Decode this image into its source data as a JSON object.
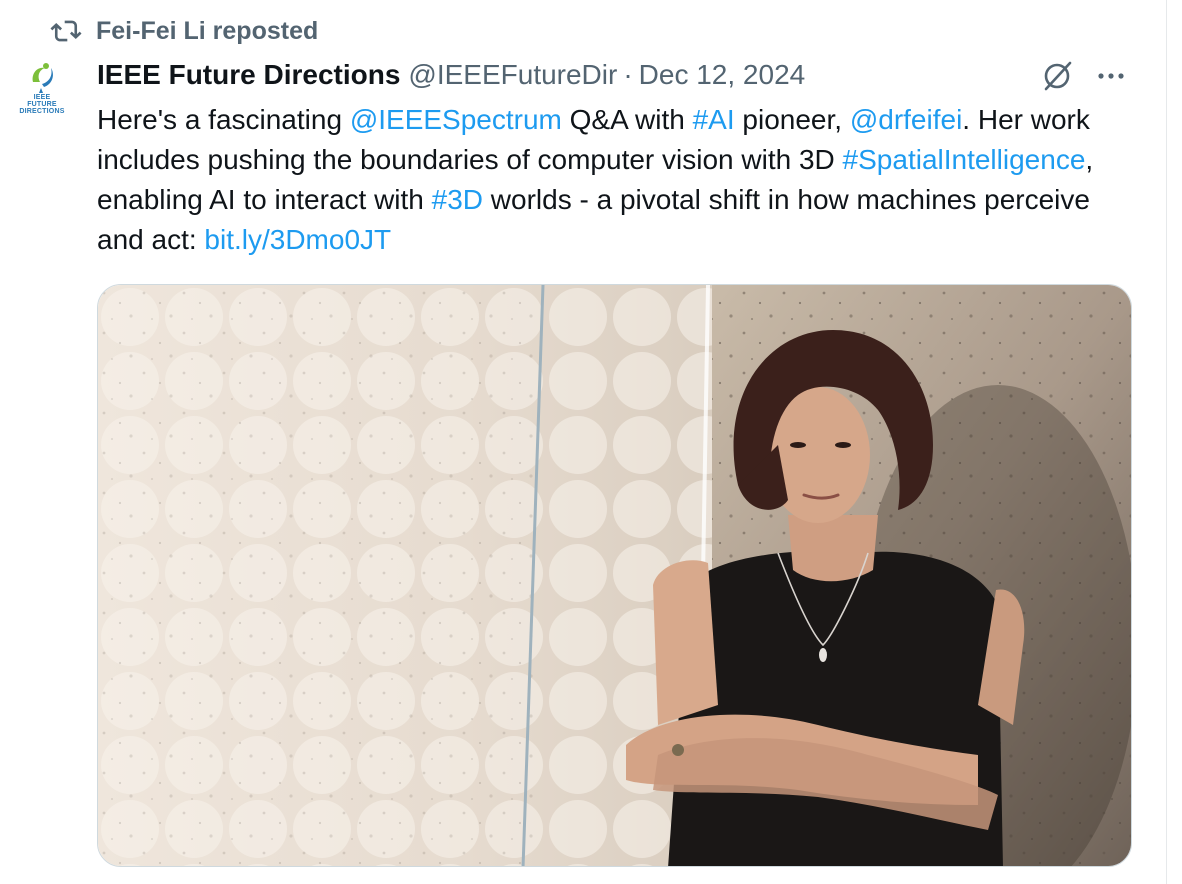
{
  "repost": {
    "label": "Fei-Fei Li reposted",
    "icon": "repost-icon"
  },
  "author": {
    "avatar_lines": [
      "IEEE",
      "FUTURE",
      "DIRECTIONS"
    ],
    "display_name": "IEEE Future Directions",
    "handle": "@IEEEFutureDir",
    "separator": "·",
    "date": "Dec 12, 2024"
  },
  "actions": {
    "grok_icon": "grok-icon",
    "more_icon": "more-icon"
  },
  "tweet": {
    "seg1": "Here's a fascinating ",
    "mention1": "@IEEESpectrum",
    "seg2": " Q&A with ",
    "hashtag1": "#AI",
    "seg3": " pioneer, ",
    "mention2": "@drfeifei",
    "seg4": ". Her work includes pushing the boundaries of computer vision with 3D ",
    "hashtag2": "#SpatialIntelligence",
    "seg5": ", enabling AI to interact with ",
    "hashtag3": "#3D",
    "seg6": " worlds - a pivotal shift in how machines perceive and act: ",
    "url": "bit.ly/3Dmo0JT"
  },
  "colors": {
    "link": "#1d9bf0",
    "secondary": "#536471",
    "primary": "#0f1419"
  }
}
